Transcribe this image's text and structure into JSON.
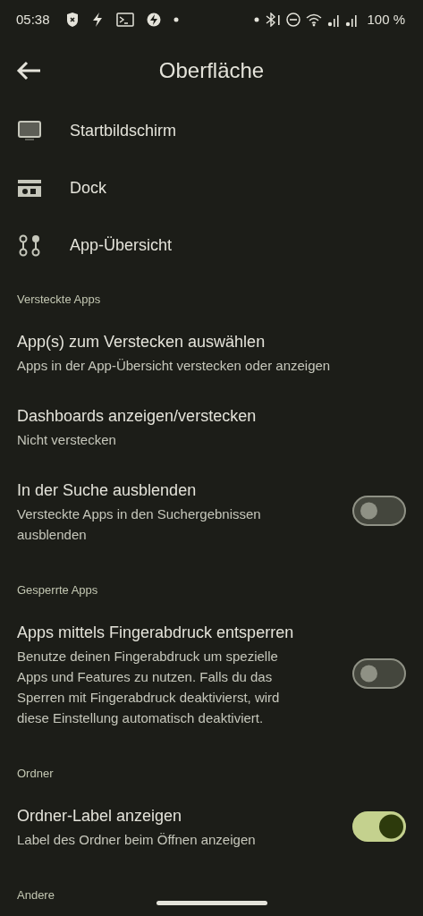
{
  "status_bar": {
    "time": "05:38",
    "battery": "100 %"
  },
  "header": {
    "title": "Oberfläche"
  },
  "nav_items": [
    {
      "label": "Startbildschirm",
      "kind": "screen"
    },
    {
      "label": "Dock",
      "kind": "dock"
    },
    {
      "label": "App-Übersicht",
      "kind": "overview"
    }
  ],
  "sections": [
    {
      "title": "Versteckte Apps",
      "items": [
        {
          "title": "App(s) zum Verstecken auswählen",
          "subtitle": "Apps in der App-Übersicht verstecken oder anzeigen",
          "kind": "plain"
        },
        {
          "title": "Dashboards anzeigen/verstecken",
          "subtitle": "Nicht verstecken",
          "kind": "plain"
        },
        {
          "title": "In der Suche ausblenden",
          "subtitle": "Versteckte Apps in den Suchergebnissen ausblenden",
          "kind": "toggle",
          "on": false
        }
      ]
    },
    {
      "title": "Gesperrte Apps",
      "items": [
        {
          "title": "Apps mittels Fingerabdruck entsperren",
          "subtitle": "Benutze deinen Fingerabdruck um spezielle Apps und Features zu nutzen. Falls du das Sperren mit Fingerabdruck deaktivierst, wird diese Einstellung automatisch deaktiviert.",
          "kind": "toggle",
          "on": false
        }
      ]
    },
    {
      "title": "Ordner",
      "items": [
        {
          "title": "Ordner-Label anzeigen",
          "subtitle": "Label des Ordner beim Öffnen anzeigen",
          "kind": "toggle",
          "on": true
        }
      ]
    },
    {
      "title": "Andere"
    }
  ]
}
